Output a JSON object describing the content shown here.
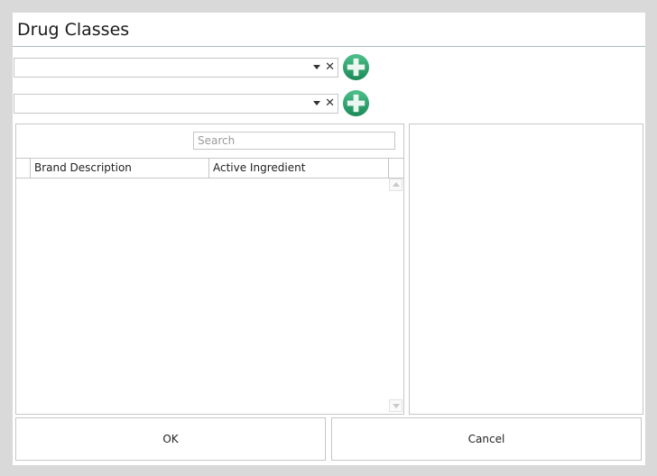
{
  "window": {
    "title": "Drug Classes"
  },
  "combos": [
    {
      "value": "",
      "clear_glyph": "✕"
    },
    {
      "value": "",
      "clear_glyph": "✕"
    }
  ],
  "add_icon": {
    "name": "plus-circle-icon",
    "color": "#2e9e6b"
  },
  "grid": {
    "search_placeholder": "Search",
    "columns": [
      "Brand Description",
      "Active Ingredient"
    ],
    "rows": []
  },
  "buttons": {
    "ok_label": "OK",
    "cancel_label": "Cancel"
  }
}
